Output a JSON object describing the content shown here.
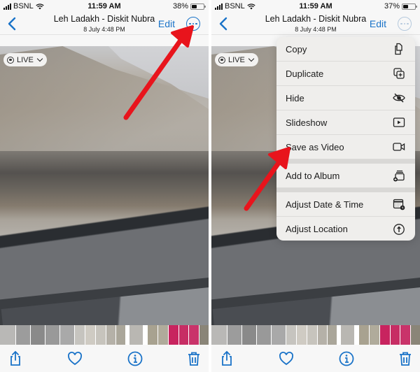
{
  "left_screen": {
    "status_bar": {
      "carrier": "BSNL",
      "time": "11:59 AM",
      "battery_pct": "38%",
      "battery_level": 0.38
    },
    "nav": {
      "back_icon": "chevron-left-icon",
      "title": "Leh Ladakh - Diskit Nubra",
      "subtitle": "8 July  4:48 PM",
      "edit_label": "Edit",
      "more_icon": "ellipsis-circle-icon"
    },
    "live_badge": {
      "icon": "live-photo-icon",
      "label": "LIVE",
      "chevron": "chevron-down-icon"
    },
    "toolbar": [
      "share-icon",
      "heart-icon",
      "info-icon",
      "trash-icon"
    ]
  },
  "right_screen": {
    "status_bar": {
      "carrier": "BSNL",
      "time": "11:59 AM",
      "battery_pct": "37%",
      "battery_level": 0.37
    },
    "nav": {
      "back_icon": "chevron-left-icon",
      "title": "Leh Ladakh - Diskit Nubra",
      "subtitle": "8 July  4:48 PM",
      "edit_label": "Edit",
      "more_icon": "ellipsis-circle-icon"
    },
    "live_badge": {
      "icon": "live-photo-icon",
      "label": "LIVE",
      "chevron": "chevron-down-icon"
    },
    "menu": {
      "items": [
        {
          "label": "Copy",
          "icon": "copy-icon"
        },
        {
          "label": "Duplicate",
          "icon": "duplicate-icon"
        },
        {
          "label": "Hide",
          "icon": "eye-slash-icon"
        },
        {
          "label": "Slideshow",
          "icon": "play-rectangle-icon"
        },
        {
          "label": "Save as Video",
          "icon": "video-camera-icon"
        },
        {
          "label": "Add to Album",
          "icon": "add-to-album-icon"
        },
        {
          "label": "Adjust Date & Time",
          "icon": "calendar-clock-icon"
        },
        {
          "label": "Adjust Location",
          "icon": "location-info-icon"
        }
      ]
    },
    "toolbar": [
      "share-icon",
      "heart-icon",
      "info-icon",
      "trash-icon"
    ]
  },
  "colors": {
    "accent": "#1a73c8",
    "annotation_arrow": "#e8141c"
  }
}
